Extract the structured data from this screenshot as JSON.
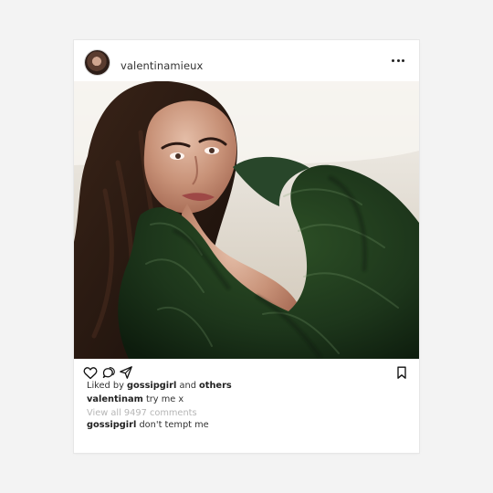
{
  "post": {
    "username": "valentinamieux",
    "likes": {
      "prefix": "Liked by",
      "user": "gossipgirl",
      "middle": "and",
      "others": "others"
    },
    "caption": {
      "user": "valentinam",
      "text": "try me x"
    },
    "comments": {
      "view_all": "View all 9497 comments"
    },
    "reply": {
      "user": "gossipgirl",
      "text": "don't tempt me"
    }
  },
  "icons": {
    "more": "more-icon",
    "like": "heart-icon",
    "comment": "comment-icon",
    "share": "paper-plane-icon",
    "bookmark": "bookmark-icon"
  },
  "colors": {
    "background": "#f3f3f3",
    "card": "#ffffff",
    "text": "#333333",
    "muted_text": "#b6b6b6",
    "fur_green": "#1f3d1d"
  }
}
